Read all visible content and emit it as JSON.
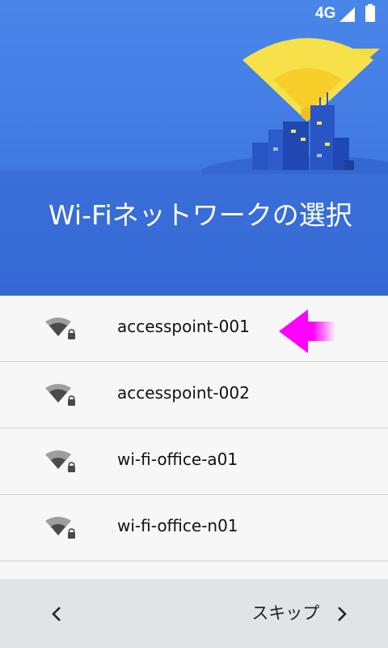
{
  "status_bar": {
    "network": "4G",
    "signal_icon": "signal-icon",
    "battery_icon": "battery-icon"
  },
  "header": {
    "title": "Wi-Fiネットワークの選択"
  },
  "networks": [
    {
      "ssid": "accesspoint-001",
      "icon": "wifi-locked-icon",
      "highlighted": true
    },
    {
      "ssid": "accesspoint-002",
      "icon": "wifi-locked-icon"
    },
    {
      "ssid": "wi-fi-office-a01",
      "icon": "wifi-locked-icon"
    },
    {
      "ssid": "wi-fi-office-n01",
      "icon": "wifi-locked-icon"
    }
  ],
  "footer": {
    "back_icon": "chevron-left-icon",
    "skip_label": "スキップ",
    "skip_icon": "chevron-right-icon"
  },
  "colors": {
    "header": "#3f79e0",
    "accent_arrow": "#ff00ff"
  }
}
